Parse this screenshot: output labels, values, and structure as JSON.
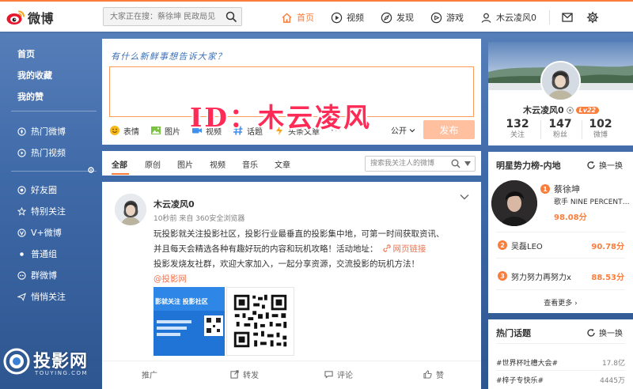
{
  "header": {
    "logo_text": "微博",
    "search_placeholder": "大家正在搜：蔡徐坤 民政局见",
    "nav": [
      {
        "label": "首页",
        "icon": "home-icon",
        "active": true
      },
      {
        "label": "视频",
        "icon": "video-icon"
      },
      {
        "label": "发现",
        "icon": "compass-icon"
      },
      {
        "label": "游戏",
        "icon": "gamepad-icon"
      },
      {
        "label": "木云凌风0",
        "icon": "user-icon"
      }
    ],
    "tools": [
      "mail-icon",
      "gear-icon"
    ],
    "accent_color": "#fa7d3c"
  },
  "leftnav": {
    "items": [
      {
        "label": "首页"
      },
      {
        "label": "我的收藏"
      },
      {
        "label": "我的赞"
      },
      {
        "label": "热门微博"
      },
      {
        "label": "热门视频"
      },
      {
        "label": "好友圈"
      },
      {
        "label": "特别关注"
      },
      {
        "label": "V+微博"
      },
      {
        "label": "普通组"
      },
      {
        "label": "群微博"
      },
      {
        "label": "悄悄关注"
      }
    ]
  },
  "publisher": {
    "prompt": "有什么新鲜事想告诉大家？",
    "tools": [
      {
        "label": "表情",
        "icon": "emoji-icon"
      },
      {
        "label": "图片",
        "icon": "image-icon"
      },
      {
        "label": "视频",
        "icon": "video-icon"
      },
      {
        "label": "话题",
        "icon": "hashtag-icon"
      },
      {
        "label": "头条文章",
        "icon": "lightning-icon"
      }
    ],
    "more": "···",
    "visibility": "公开",
    "send_label": "发布",
    "overlay_text": "ID：木云凌风"
  },
  "feed_tabs": {
    "tabs": [
      "全部",
      "原创",
      "图片",
      "视频",
      "音乐",
      "文章"
    ],
    "active": 0,
    "search_placeholder": "搜索我关注人的微博"
  },
  "post": {
    "author": "木云凌风0",
    "meta": "10秒前 来自 360安全浏览器",
    "line1": "玩投影就关注投影社区，投影行业最垂直的投影集中地，可第一时间获取资讯、",
    "line2": "并且每天会精选各种有趣好玩的内容和玩机攻略！活动地址：",
    "link_text": "网页链接",
    "line3": "投影发烧友社群，欢迎大家加入，一起分享资源，交流投影的玩机方法！",
    "mention": "@投影网",
    "image1_text": "影就关注  投影社区",
    "actions": [
      {
        "label": "推广",
        "icon": ""
      },
      {
        "label": "转发",
        "icon": "share-icon"
      },
      {
        "label": "评论",
        "icon": "comment-icon"
      },
      {
        "label": "赞",
        "icon": "thumbs-up-icon"
      }
    ]
  },
  "usercard": {
    "name": "木云凌风0",
    "level": "Lv22",
    "stats": [
      {
        "n": "132",
        "label": "关注"
      },
      {
        "n": "147",
        "label": "粉丝"
      },
      {
        "n": "102",
        "label": "微博"
      }
    ]
  },
  "rank": {
    "title": "明星势力榜-内地",
    "refresh": "换一换",
    "top": {
      "num": "1",
      "name": "蔡徐坤",
      "desc": "歌手 NINE PERCENT…",
      "score": "98.08分"
    },
    "rows": [
      {
        "num": "2",
        "name": "吴磊LEO",
        "score": "90.78分"
      },
      {
        "num": "3",
        "name": "努力努力再努力x",
        "score": "88.53分"
      }
    ],
    "more": "查看更多 ›"
  },
  "hot": {
    "title": "热门话题",
    "refresh": "换一换",
    "rows": [
      {
        "topic": "#世界杯吐槽大会#",
        "count": "17.8亿"
      },
      {
        "topic": "#梓子专快乐#",
        "count": "4445万"
      }
    ]
  },
  "site_watermark": {
    "text": "投影网",
    "sub": "TOUYING.COM"
  }
}
